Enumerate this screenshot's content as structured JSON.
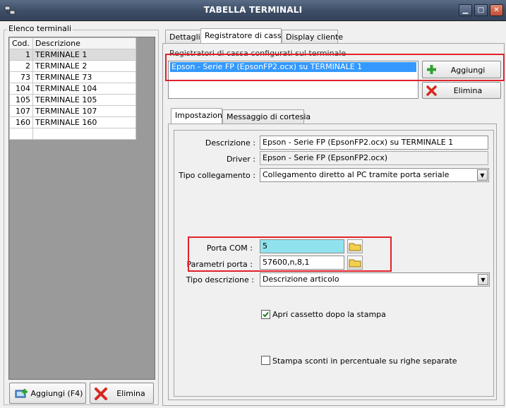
{
  "window": {
    "title": "TABELLA TERMINALI",
    "minimize": "▁",
    "maximize": "□",
    "close": "✕"
  },
  "left": {
    "legend": "Elenco terminali",
    "columns": [
      "Cod.",
      "Descrizione"
    ],
    "rows": [
      {
        "code": "1",
        "desc": "TERMINALE 1"
      },
      {
        "code": "2",
        "desc": "TERMINALE 2"
      },
      {
        "code": "73",
        "desc": "TERMINALE 73"
      },
      {
        "code": "104",
        "desc": "TERMINALE 104"
      },
      {
        "code": "105",
        "desc": "TERMINALE 105"
      },
      {
        "code": "107",
        "desc": "TERMINALE 107"
      },
      {
        "code": "160",
        "desc": "TERMINALE 160"
      }
    ],
    "add_label": "Aggiungi (F4)",
    "delete_label": "Elimina"
  },
  "tabs": [
    "Dettagli",
    "Registratore di cassa",
    "Display cliente"
  ],
  "registers": {
    "caption": "Registratori di cassa configurati sul terminale",
    "selected": "Epson - Serie FP (EpsonFP2.ocx) su TERMINALE 1",
    "add_label": "Aggiungi",
    "delete_label": "Elimina"
  },
  "subtabs": [
    "Impostazioni",
    "Messaggio di cortesia"
  ],
  "settings": {
    "descrizione_label": "Descrizione :",
    "descrizione_value": "Epson - Serie FP (EpsonFP2.ocx) su TERMINALE 1",
    "driver_label": "Driver :",
    "driver_value": "Epson - Serie FP (EpsonFP2.ocx)",
    "collegamento_label": "Tipo collegamento :",
    "collegamento_value": "Collegamento diretto al PC tramite porta seriale",
    "porta_label": "Porta COM :",
    "porta_value": "5",
    "parametri_label": "Parametri porta :",
    "parametri_value": "57600,n,8,1",
    "tipodesc_label": "Tipo descrizione :",
    "tipodesc_value": "Descrizione articolo",
    "apri_label": "Apri cassetto dopo la stampa",
    "apri_checked": true,
    "sconti_label": "Stampa sconti in percentuale su righe separate",
    "sconti_checked": false
  },
  "colors": {
    "highlight_outline": "#e0222a",
    "selection": "#3399ff",
    "com_field_bg": "#90e2ee"
  }
}
